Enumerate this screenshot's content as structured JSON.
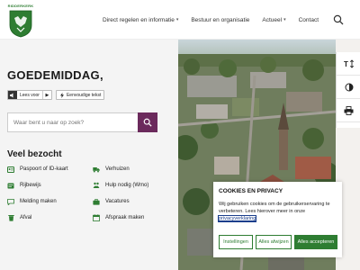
{
  "header": {
    "logo_text": "RIDDERKERK",
    "nav": [
      {
        "label": "Direct regelen en informatie",
        "dropdown": true
      },
      {
        "label": "Bestuur en organisatie",
        "dropdown": false
      },
      {
        "label": "Actueel",
        "dropdown": true
      },
      {
        "label": "Contact",
        "dropdown": false
      }
    ],
    "search_icon": "search-icon"
  },
  "hero": {
    "greeting": "GOEDEMIDDAG,",
    "read_button": "Lees voor",
    "simple_text_button": "Eenvoudige tekst",
    "search_placeholder": "Waar bent u naar op zoek?"
  },
  "visited": {
    "title": "Veel bezocht",
    "links": [
      {
        "label": "Paspoort of ID-kaart",
        "icon": "id-card-icon"
      },
      {
        "label": "Verhuizen",
        "icon": "truck-icon"
      },
      {
        "label": "Rijbewijs",
        "icon": "license-icon"
      },
      {
        "label": "Hulp nodig (Wmo)",
        "icon": "help-icon"
      },
      {
        "label": "Melding maken",
        "icon": "message-icon"
      },
      {
        "label": "Vacatures",
        "icon": "briefcase-icon"
      },
      {
        "label": "Afval",
        "icon": "trash-icon"
      },
      {
        "label": "Afspraak maken",
        "icon": "calendar-icon"
      }
    ]
  },
  "tools": [
    "text-size-icon",
    "contrast-icon",
    "print-icon"
  ],
  "cookie": {
    "title": "COOKIES EN PRIVACY",
    "text": "Wij gebruiken cookies om de gebruikerservaring te verbeteren. Lees hierover meer in onze",
    "link": "privacyverklaring",
    "buttons": {
      "settings": "Instellingen",
      "reject": "Alles afwijzen",
      "accept": "Alles accepteren"
    }
  },
  "colors": {
    "brand_green": "#2e7d32",
    "search_button": "#6b2a5c"
  }
}
